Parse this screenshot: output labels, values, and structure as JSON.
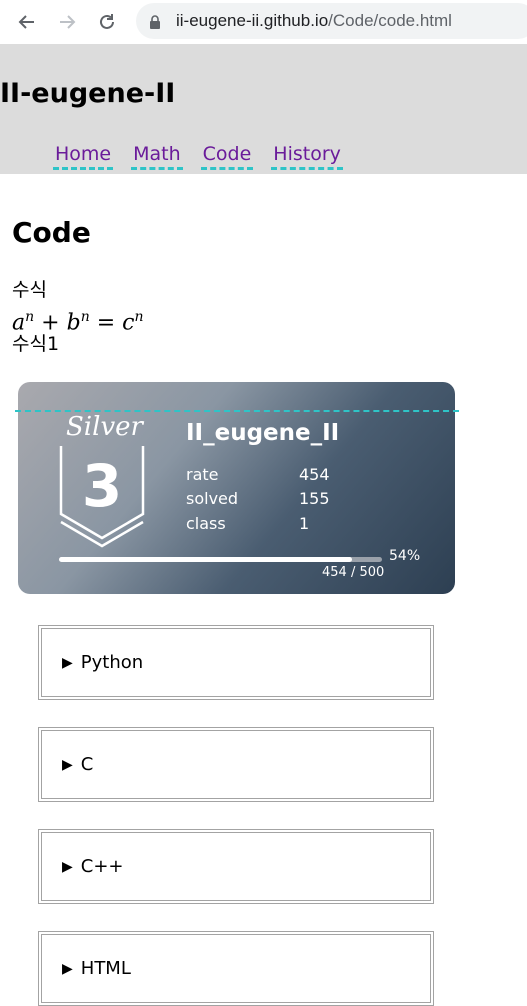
{
  "browser": {
    "url_host": "ii-eugene-ii.github.io",
    "url_path": "/Code/code.html"
  },
  "site": {
    "title": "II-eugene-II",
    "nav": [
      "Home",
      "Math",
      "Code",
      "History"
    ]
  },
  "main": {
    "heading": "Code",
    "line1": "수식",
    "formula": {
      "a": "a",
      "n1": "n",
      "plus": "+",
      "b": "b",
      "n2": "n",
      "eq": "=",
      "c": "c",
      "n3": "n"
    },
    "line2": "수식1"
  },
  "badge": {
    "tier_name": "Silver",
    "tier_level": "3",
    "handle": "II_eugene_II",
    "stats": [
      {
        "label": "rate",
        "value": "454"
      },
      {
        "label": "solved",
        "value": "155"
      },
      {
        "label": "class",
        "value": "1"
      }
    ],
    "progress_percent": "54%",
    "progress_fraction": 0.908,
    "progress_text": "454 / 500",
    "colors": {
      "gradient_start": "#a9a9ae",
      "gradient_end": "#2d3f52"
    }
  },
  "sections": [
    {
      "marker": "▶",
      "label": "Python"
    },
    {
      "marker": "▶",
      "label": "C"
    },
    {
      "marker": "▶",
      "label": "C++"
    },
    {
      "marker": "▶",
      "label": "HTML"
    }
  ],
  "colors": {
    "header_bg": "#dcdcdc",
    "nav_link": "#6a1b9a",
    "nav_underline": "#2ec4c7"
  }
}
